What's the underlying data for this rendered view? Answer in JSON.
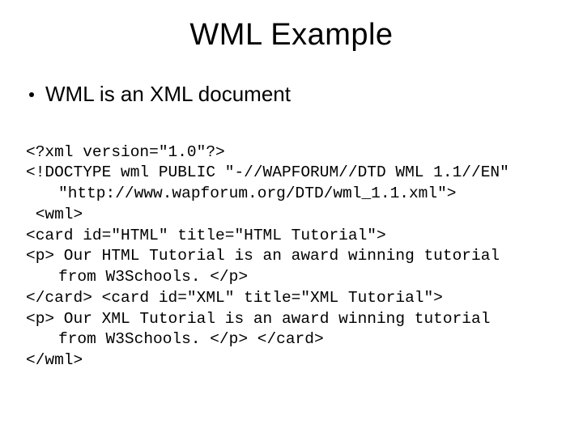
{
  "title": "WML Example",
  "bullet": "WML is an XML document",
  "code": {
    "l1": "<?xml version=\"1.0\"?>",
    "l2": "<!DOCTYPE wml PUBLIC \"-//WAPFORUM//DTD WML 1.1//EN\"",
    "l3": "\"http://www.wapforum.org/DTD/wml_1.1.xml\">",
    "l4": " <wml>",
    "l5": "<card id=\"HTML\" title=\"HTML Tutorial\">",
    "l6": "<p> Our HTML Tutorial is an award winning tutorial",
    "l7": "from W3Schools. </p>",
    "l8": "</card> <card id=\"XML\" title=\"XML Tutorial\">",
    "l9": "<p> Our XML Tutorial is an award winning tutorial",
    "l10": "from W3Schools. </p> </card>",
    "l11": "</wml>"
  }
}
